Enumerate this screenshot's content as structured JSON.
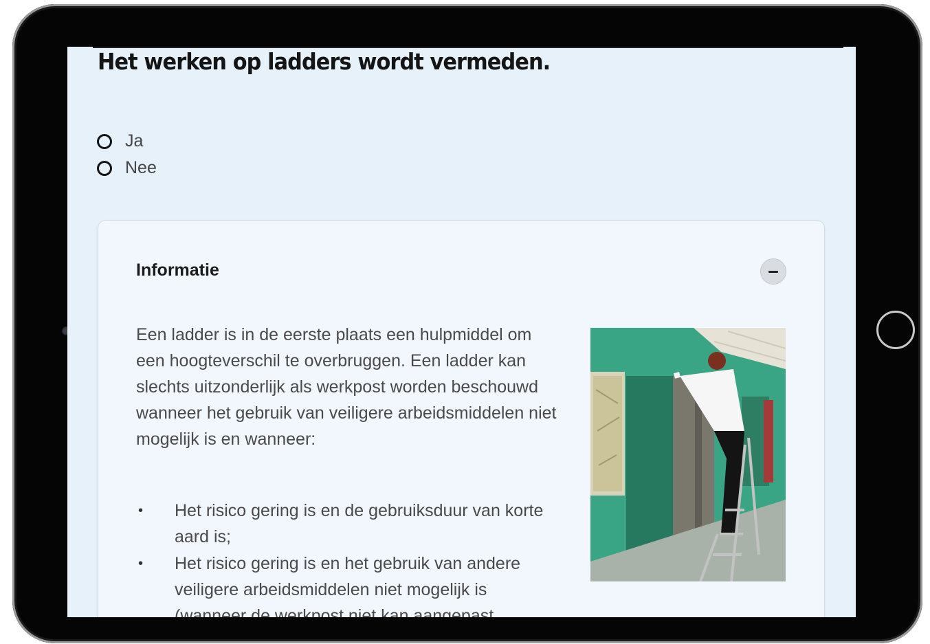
{
  "question": "Het werken op ladders wordt vermeden.",
  "options": [
    {
      "label": "Ja",
      "selected": false
    },
    {
      "label": "Nee",
      "selected": false
    }
  ],
  "info": {
    "title": "Informatie",
    "collapse_icon": "minus-icon",
    "paragraph": "Een ladder is in de eerste plaats een hulpmiddel om een hoogteverschil te overbruggen. Een ladder kan slechts uitzonderlijk als werkpost worden beschouwd wanneer het gebruik van veiligere arbeidsmiddelen niet mogelijk is en wanneer:",
    "bullets": [
      "Het risico gering is en de gebruiksduur van korte aard is;",
      "Het risico gering is en het gebruik van andere veiligere arbeidsmiddelen niet mogelijk is (wanneer de werkpost niet kan aangepast"
    ],
    "bullet_glyph": "•"
  },
  "colors": {
    "screen_bg": "#e7f1fa",
    "card_bg": "#f1f7fc",
    "wall": "#3aa585",
    "cabinet": "#26795f"
  }
}
